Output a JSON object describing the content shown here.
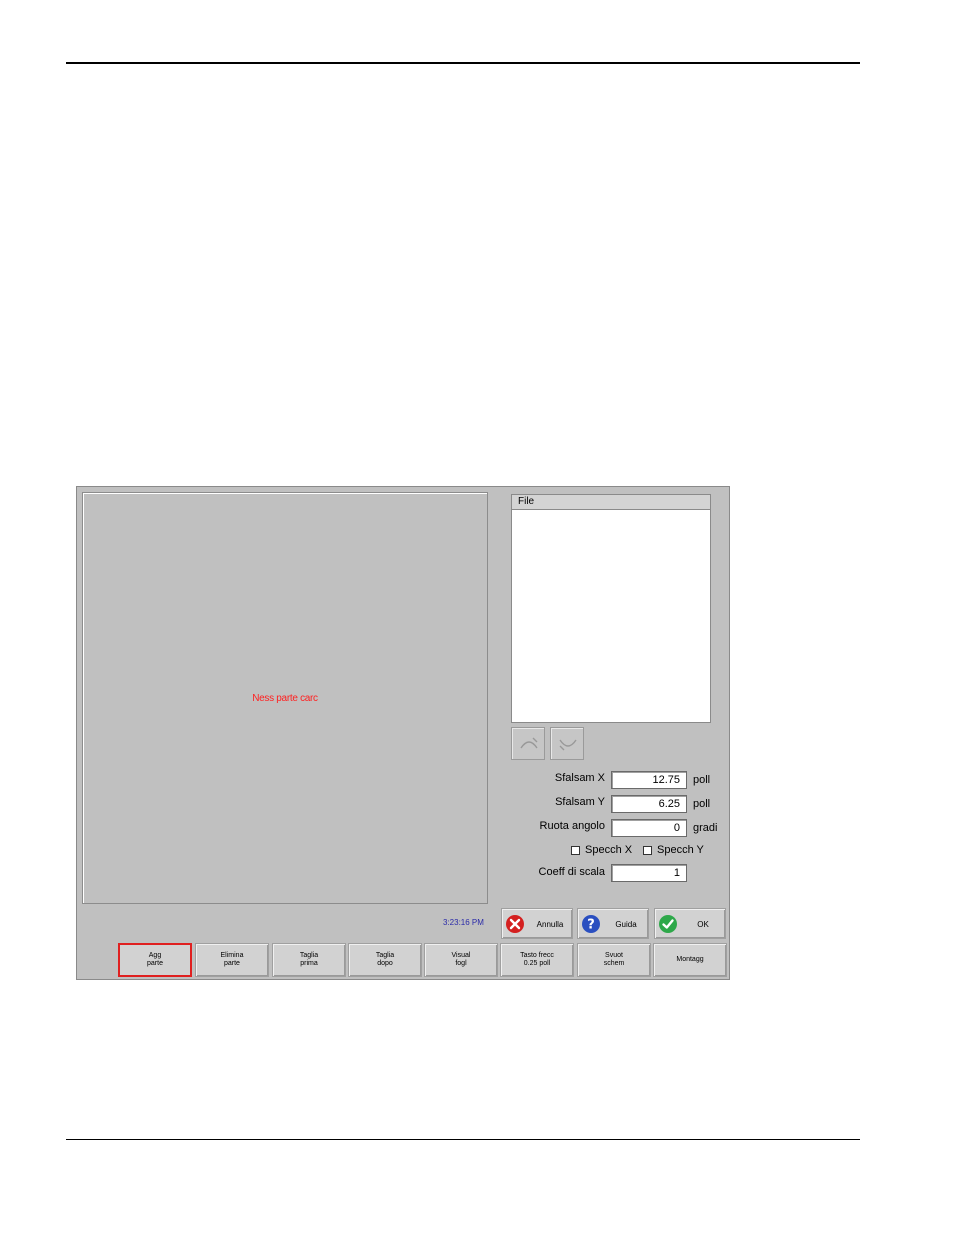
{
  "viewport": {
    "message": "Ness parte carc"
  },
  "file_panel": {
    "header": "File"
  },
  "fields": {
    "offset_x": {
      "label": "Sfalsam X",
      "value": "12.75",
      "unit": "poll"
    },
    "offset_y": {
      "label": "Sfalsam Y",
      "value": "6.25",
      "unit": "poll"
    },
    "rotate": {
      "label": "Ruota angolo",
      "value": "0",
      "unit": "gradi"
    },
    "scale": {
      "label": "Coeff di scala",
      "value": "1"
    }
  },
  "checkboxes": {
    "mirror_x": "Specch X",
    "mirror_y": "Specch Y"
  },
  "status": {
    "time": "3:23:16 PM"
  },
  "actions": {
    "cancel": "Annulla",
    "help": "Guida",
    "ok": "OK"
  },
  "function_keys": [
    {
      "label": "Agg\nparte",
      "selected": true
    },
    {
      "label": "Elimina\nparte"
    },
    {
      "label": "Taglia\nprima"
    },
    {
      "label": "Taglia\ndopo"
    },
    {
      "label": "Visual\nfogl"
    },
    {
      "label": "Tasto frecc\n0.25 poll"
    },
    {
      "label": "Svuot\nschem"
    },
    {
      "label": "Montagg"
    }
  ],
  "colors": {
    "selected_outline": "#e02020",
    "message": "#ff2020"
  }
}
